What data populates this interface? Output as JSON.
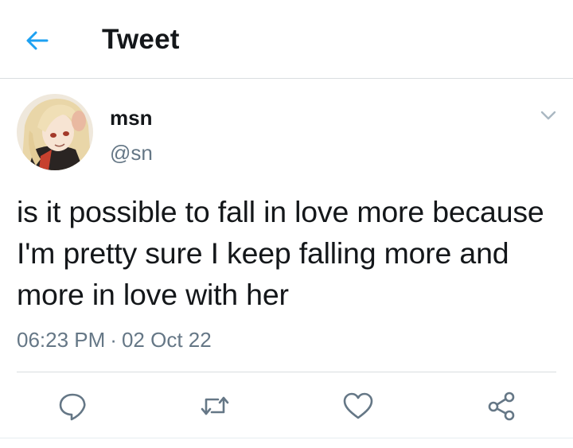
{
  "header": {
    "title": "Tweet",
    "back_icon": "back-arrow-icon",
    "accent_color": "#1da1f2"
  },
  "tweet": {
    "author": {
      "display_name": "msn",
      "handle": "@sn"
    },
    "text": "is it possible to fall in love more because I'm pretty sure I keep falling more and more in love with her",
    "time": "06:23 PM",
    "separator": "·",
    "date": "02 Oct 22"
  },
  "actions": [
    {
      "name": "reply",
      "icon": "reply-icon"
    },
    {
      "name": "retweet",
      "icon": "retweet-icon"
    },
    {
      "name": "like",
      "icon": "heart-icon"
    },
    {
      "name": "share",
      "icon": "share-icon"
    }
  ],
  "colors": {
    "text": "#14171a",
    "secondary": "#657786",
    "divider": "#d9dde0"
  }
}
